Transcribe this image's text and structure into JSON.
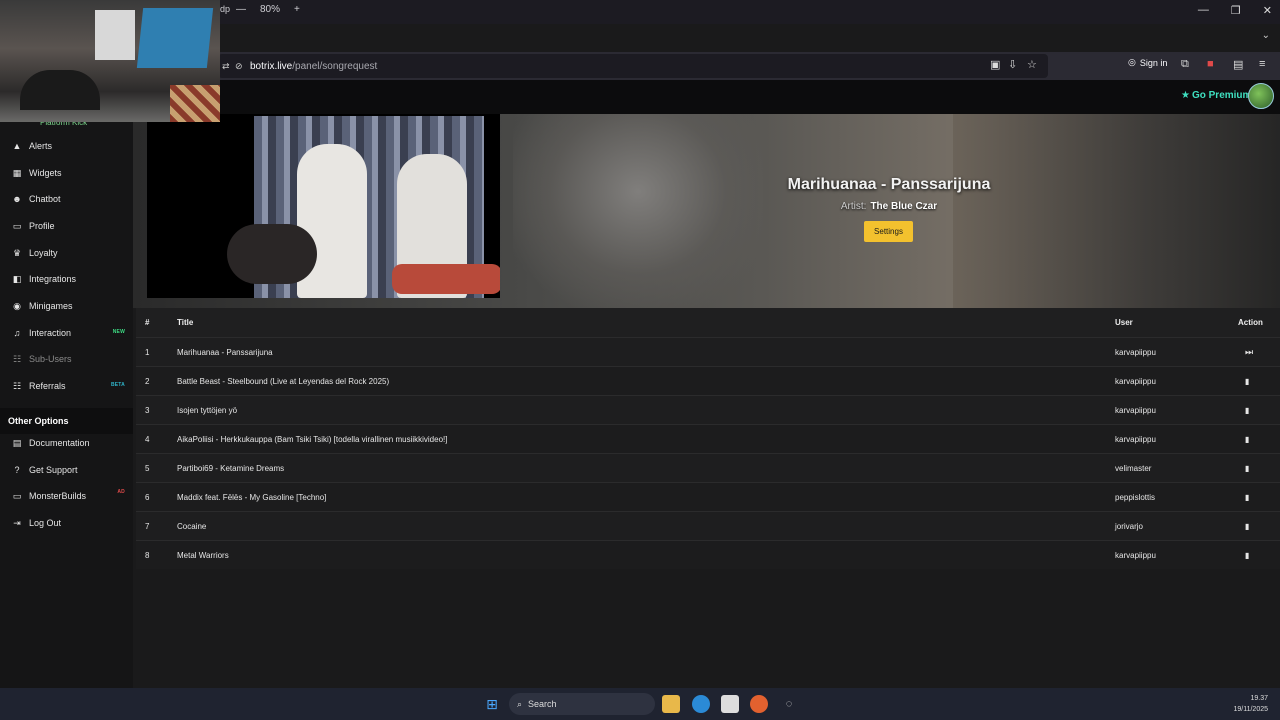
{
  "browser": {
    "tab_fragment": "dp",
    "zoom": "80%",
    "zoom_minus": "—",
    "zoom_plus": "+",
    "url_host": "botrix.live",
    "url_path": "/panel/songrequest",
    "sign_in": "Sign in",
    "window_controls": [
      "—",
      "❐",
      "✕"
    ]
  },
  "header": {
    "premium_label": "Go Premium",
    "premium_color": "#3fe0c0"
  },
  "sidebar": {
    "cut_text": "Platform Kick",
    "items": [
      {
        "label": "Alerts",
        "icon": "warning-icon",
        "glyph": "▲"
      },
      {
        "label": "Widgets",
        "icon": "grid-icon",
        "glyph": "▦"
      },
      {
        "label": "Chatbot",
        "icon": "robot-icon",
        "glyph": "☻"
      },
      {
        "label": "Profile",
        "icon": "id-card-icon",
        "glyph": "▭"
      },
      {
        "label": "Loyalty",
        "icon": "trophy-icon",
        "glyph": "♛"
      },
      {
        "label": "Integrations",
        "icon": "plug-icon",
        "glyph": "◧"
      },
      {
        "label": "Minigames",
        "icon": "gamepad-icon",
        "glyph": "◉"
      },
      {
        "label": "Interaction",
        "icon": "music-icon",
        "glyph": "♫",
        "badge": "NEW",
        "badge_color": "#3ddc84"
      },
      {
        "label": "Sub-Users",
        "icon": "users-icon",
        "glyph": "☷",
        "dim": true
      },
      {
        "label": "Referrals",
        "icon": "user-group-icon",
        "glyph": "☷",
        "badge": "BETA",
        "badge_color": "#2fb3c8"
      }
    ],
    "other_header": "Other Options",
    "other_items": [
      {
        "label": "Documentation",
        "icon": "book-icon",
        "glyph": "▤"
      },
      {
        "label": "Get Support",
        "icon": "question-icon",
        "glyph": "?"
      },
      {
        "label": "MonsterBuilds",
        "icon": "laptop-icon",
        "glyph": "▭",
        "badge": "AD",
        "badge_color": "#e04a4a"
      },
      {
        "label": "Log Out",
        "icon": "logout-icon",
        "glyph": "⇥"
      }
    ]
  },
  "now_playing": {
    "title": "Marihuanaa - Panssarijuna",
    "artist_label": "Artist:",
    "artist": "The Blue Czar",
    "settings_label": "Settings",
    "settings_color": "#f3c12e"
  },
  "table": {
    "headers": {
      "num": "#",
      "title": "Title",
      "user": "User",
      "action": "Action"
    },
    "rows": [
      {
        "num": "1",
        "title": "Marihuanaa - Panssarijuna",
        "user": "karvapiippu",
        "action": "skip-icon"
      },
      {
        "num": "2",
        "title": "Battle Beast - Steelbound (Live at Leyendas del Rock 2025)",
        "user": "karvapiippu",
        "action": "trash-icon"
      },
      {
        "num": "3",
        "title": "Isojen tyttöjen yö",
        "user": "karvapiippu",
        "action": "trash-icon"
      },
      {
        "num": "4",
        "title": "AikaPoliisi - Herkkukauppa (Bam Tsiki Tsiki) [todella virallinen musiikkivideo!]",
        "user": "karvapiippu",
        "action": "trash-icon"
      },
      {
        "num": "5",
        "title": "Partiboi69 - Ketamine Dreams",
        "user": "velimaster",
        "action": "trash-icon"
      },
      {
        "num": "6",
        "title": "Maddix feat. Fēlēs - My Gasoline [Techno]",
        "user": "peppislottis",
        "action": "trash-icon"
      },
      {
        "num": "7",
        "title": "Cocaine",
        "user": "jorivarjo",
        "action": "trash-icon"
      },
      {
        "num": "8",
        "title": "Metal Warriors",
        "user": "karvapiippu",
        "action": "trash-icon"
      }
    ]
  },
  "taskbar": {
    "search_label": "Search",
    "time": "19.37",
    "date": "19/11/2025"
  }
}
